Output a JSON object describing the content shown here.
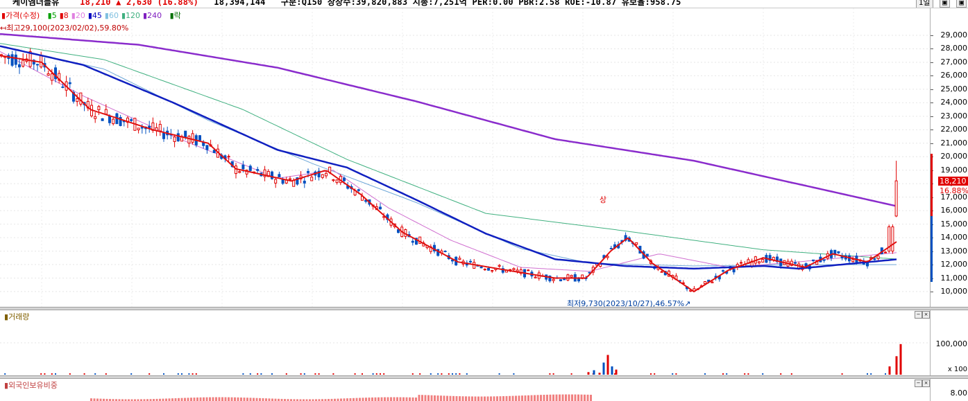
{
  "header": {
    "stock_name": "케이엠더블유",
    "price": "18,210",
    "change_arrow": "▲",
    "change": "2,630",
    "change_pct": "(16.88%)",
    "volume": "18,394,144",
    "market": "구분:Q150",
    "shares": "상장수:39,820,883",
    "market_cap": "시총:7,251억",
    "per": "PER:0.00",
    "pbr": "PBR:2.58",
    "roe": "ROE:-10.87",
    "retention": "유보율:958.75",
    "period_button": "1일"
  },
  "legend": {
    "price_label": "가격(수정)",
    "ma_items": [
      {
        "label": "5",
        "color": "#00a000"
      },
      {
        "label": "8",
        "color": "#e00000"
      },
      {
        "label": "20",
        "color": "#e080e0"
      },
      {
        "label": "45",
        "color": "#0000c0"
      },
      {
        "label": "60",
        "color": "#80c0e0"
      },
      {
        "label": "120",
        "color": "#40b080"
      },
      {
        "label": "240",
        "color": "#8020c0"
      }
    ],
    "extra_label": "락"
  },
  "annotations": {
    "high": "최고29,100(2023/02/02),59.80%",
    "low": "최저9,730(2023/10/27),46.57%",
    "sang_marker": "상"
  },
  "price_axis": {
    "ticks": [
      "29,000",
      "28,000",
      "27,000",
      "26,000",
      "25,000",
      "24,000",
      "23,000",
      "22,000",
      "21,000",
      "20,000",
      "19,000",
      "18,000",
      "17,000",
      "16,000",
      "15,000",
      "14,000",
      "13,000",
      "12,000",
      "11,000",
      "10,000"
    ],
    "current_price": "18,210",
    "current_pct": "16.88%"
  },
  "volume_panel": {
    "title": "거래량",
    "ticks": [
      "100,000",
      "x 100"
    ]
  },
  "foreign_panel": {
    "title": "외국인보유비중",
    "ticks": [
      "8.00"
    ]
  },
  "colors": {
    "up": "#e00000",
    "down": "#0050c0",
    "ma240": "#8020c0",
    "ma45": "#0000c0",
    "ma8": "#e00000"
  },
  "chart_data": {
    "type": "candlestick",
    "title": "",
    "ylim": [
      9500,
      30000
    ],
    "ma_lines": {
      "ma240": [
        [
          0,
          29100
        ],
        [
          200,
          28300
        ],
        [
          400,
          26600
        ],
        [
          600,
          24100
        ],
        [
          800,
          21300
        ],
        [
          1000,
          19700
        ],
        [
          1200,
          17400
        ],
        [
          1295,
          16300
        ]
      ],
      "ma120": [
        [
          0,
          28400
        ],
        [
          150,
          27200
        ],
        [
          350,
          23500
        ],
        [
          500,
          19800
        ],
        [
          700,
          15800
        ],
        [
          900,
          14500
        ],
        [
          1100,
          13100
        ],
        [
          1295,
          12400
        ]
      ],
      "ma60": [
        [
          0,
          28200
        ],
        [
          150,
          26500
        ],
        [
          300,
          22700
        ],
        [
          450,
          19500
        ],
        [
          600,
          16600
        ],
        [
          750,
          13200
        ],
        [
          850,
          12100
        ],
        [
          1000,
          11900
        ],
        [
          1150,
          12000
        ],
        [
          1295,
          12000
        ]
      ],
      "ma45": [
        [
          0,
          28200
        ],
        [
          120,
          26800
        ],
        [
          250,
          24000
        ],
        [
          400,
          20500
        ],
        [
          500,
          19200
        ],
        [
          600,
          16800
        ],
        [
          700,
          14300
        ],
        [
          800,
          12400
        ],
        [
          900,
          11900
        ],
        [
          1000,
          11700
        ],
        [
          1100,
          11900
        ],
        [
          1150,
          11700
        ],
        [
          1295,
          12400
        ]
      ],
      "ma20": [
        [
          0,
          27800
        ],
        [
          120,
          24500
        ],
        [
          250,
          21500
        ],
        [
          400,
          18400
        ],
        [
          480,
          19000
        ],
        [
          560,
          16200
        ],
        [
          650,
          13800
        ],
        [
          750,
          11800
        ],
        [
          850,
          11500
        ],
        [
          950,
          12800
        ],
        [
          1050,
          11800
        ],
        [
          1150,
          12200
        ],
        [
          1295,
          12900
        ]
      ],
      "ma8": [
        [
          0,
          27500
        ],
        [
          60,
          27000
        ],
        [
          130,
          23500
        ],
        [
          220,
          22000
        ],
        [
          300,
          21000
        ],
        [
          340,
          19100
        ],
        [
          420,
          18200
        ],
        [
          470,
          19000
        ],
        [
          520,
          17200
        ],
        [
          580,
          14400
        ],
        [
          660,
          12200
        ],
        [
          740,
          11500
        ],
        [
          800,
          11000
        ],
        [
          845,
          11000
        ],
        [
          880,
          13000
        ],
        [
          905,
          14000
        ],
        [
          940,
          12100
        ],
        [
          1000,
          10000
        ],
        [
          1050,
          11600
        ],
        [
          1100,
          12500
        ],
        [
          1160,
          11800
        ],
        [
          1200,
          12800
        ],
        [
          1250,
          12200
        ],
        [
          1295,
          13800
        ]
      ]
    },
    "candles_note": "OHLC candles rendered procedurally along the 8-day line path",
    "volume_spikes": [
      [
        848,
        8000
      ],
      [
        856,
        14000
      ],
      [
        864,
        6000
      ],
      [
        870,
        38000
      ],
      [
        876,
        62000
      ],
      [
        882,
        26000
      ],
      [
        888,
        16000
      ],
      [
        1282,
        26000
      ],
      [
        1292,
        58000
      ],
      [
        1298,
        96000
      ]
    ]
  }
}
